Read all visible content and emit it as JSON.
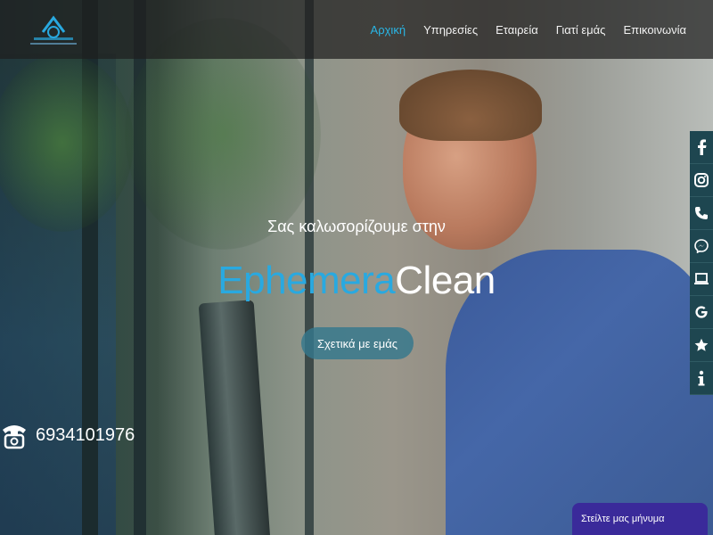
{
  "header": {
    "logo": {
      "name": "ephemeraclean-logo",
      "text": "EphemeraClean"
    },
    "nav": [
      {
        "label": "Αρχική",
        "active": true
      },
      {
        "label": "Υπηρεσίες",
        "active": false
      },
      {
        "label": "Εταιρεία",
        "active": false
      },
      {
        "label": "Γιατί εμάς",
        "active": false
      },
      {
        "label": "Επικοινωνία",
        "active": false
      }
    ]
  },
  "hero": {
    "welcome": "Σας καλωσορίζουμε στην",
    "brand_part1": "Ephemera",
    "brand_part2": "Clean",
    "button_label": "Σχετικά με εμάς"
  },
  "contact": {
    "phone": "6934101976",
    "icon": "phone-icon"
  },
  "social": {
    "items": [
      "facebook-icon",
      "instagram-icon",
      "phone-icon",
      "messenger-icon",
      "laptop-icon",
      "google-icon",
      "star-icon",
      "info-icon"
    ]
  },
  "chat": {
    "label": "Στείλτε μας μήνυμα"
  },
  "colors": {
    "accent": "#29b6e6",
    "brand_blue": "#29a9e0",
    "social_bg": "#1e4650",
    "chat_bg": "#3a2a9a"
  }
}
